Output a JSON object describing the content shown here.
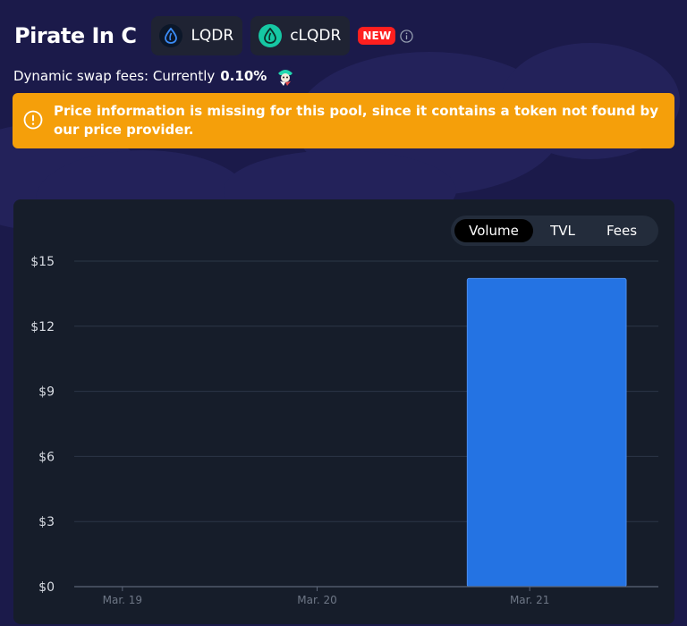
{
  "header": {
    "title": "Pirate In C",
    "tokens": [
      {
        "symbol": "LQDR",
        "icon": "liquid-drop-icon",
        "color": "#0c1729"
      },
      {
        "symbol": "cLQDR",
        "icon": "liquid-drop-icon",
        "color": "#16c7a4"
      }
    ],
    "badge": "NEW",
    "info_icon": "info-icon"
  },
  "fees": {
    "label": "Dynamic swap fees: Currently",
    "value": "0.10%",
    "icon": "mascot-icon"
  },
  "warning": {
    "text": "Price information is missing for this pool, since it contains a token not found by our price provider.",
    "icon": "exclamation-circle-icon",
    "color": "#f59f0a"
  },
  "chart_toggle": {
    "options": [
      "Volume",
      "TVL",
      "Fees"
    ],
    "active": "Volume"
  },
  "chart_data": {
    "type": "bar",
    "categories": [
      "Mar. 19",
      "Mar. 20",
      "Mar. 21"
    ],
    "values": [
      0,
      0,
      14.2
    ],
    "y_ticks": [
      "$0",
      "$3",
      "$6",
      "$9",
      "$12",
      "$15"
    ],
    "ylim": [
      0,
      15
    ],
    "grid": true,
    "bar_color": "#2473e3"
  }
}
